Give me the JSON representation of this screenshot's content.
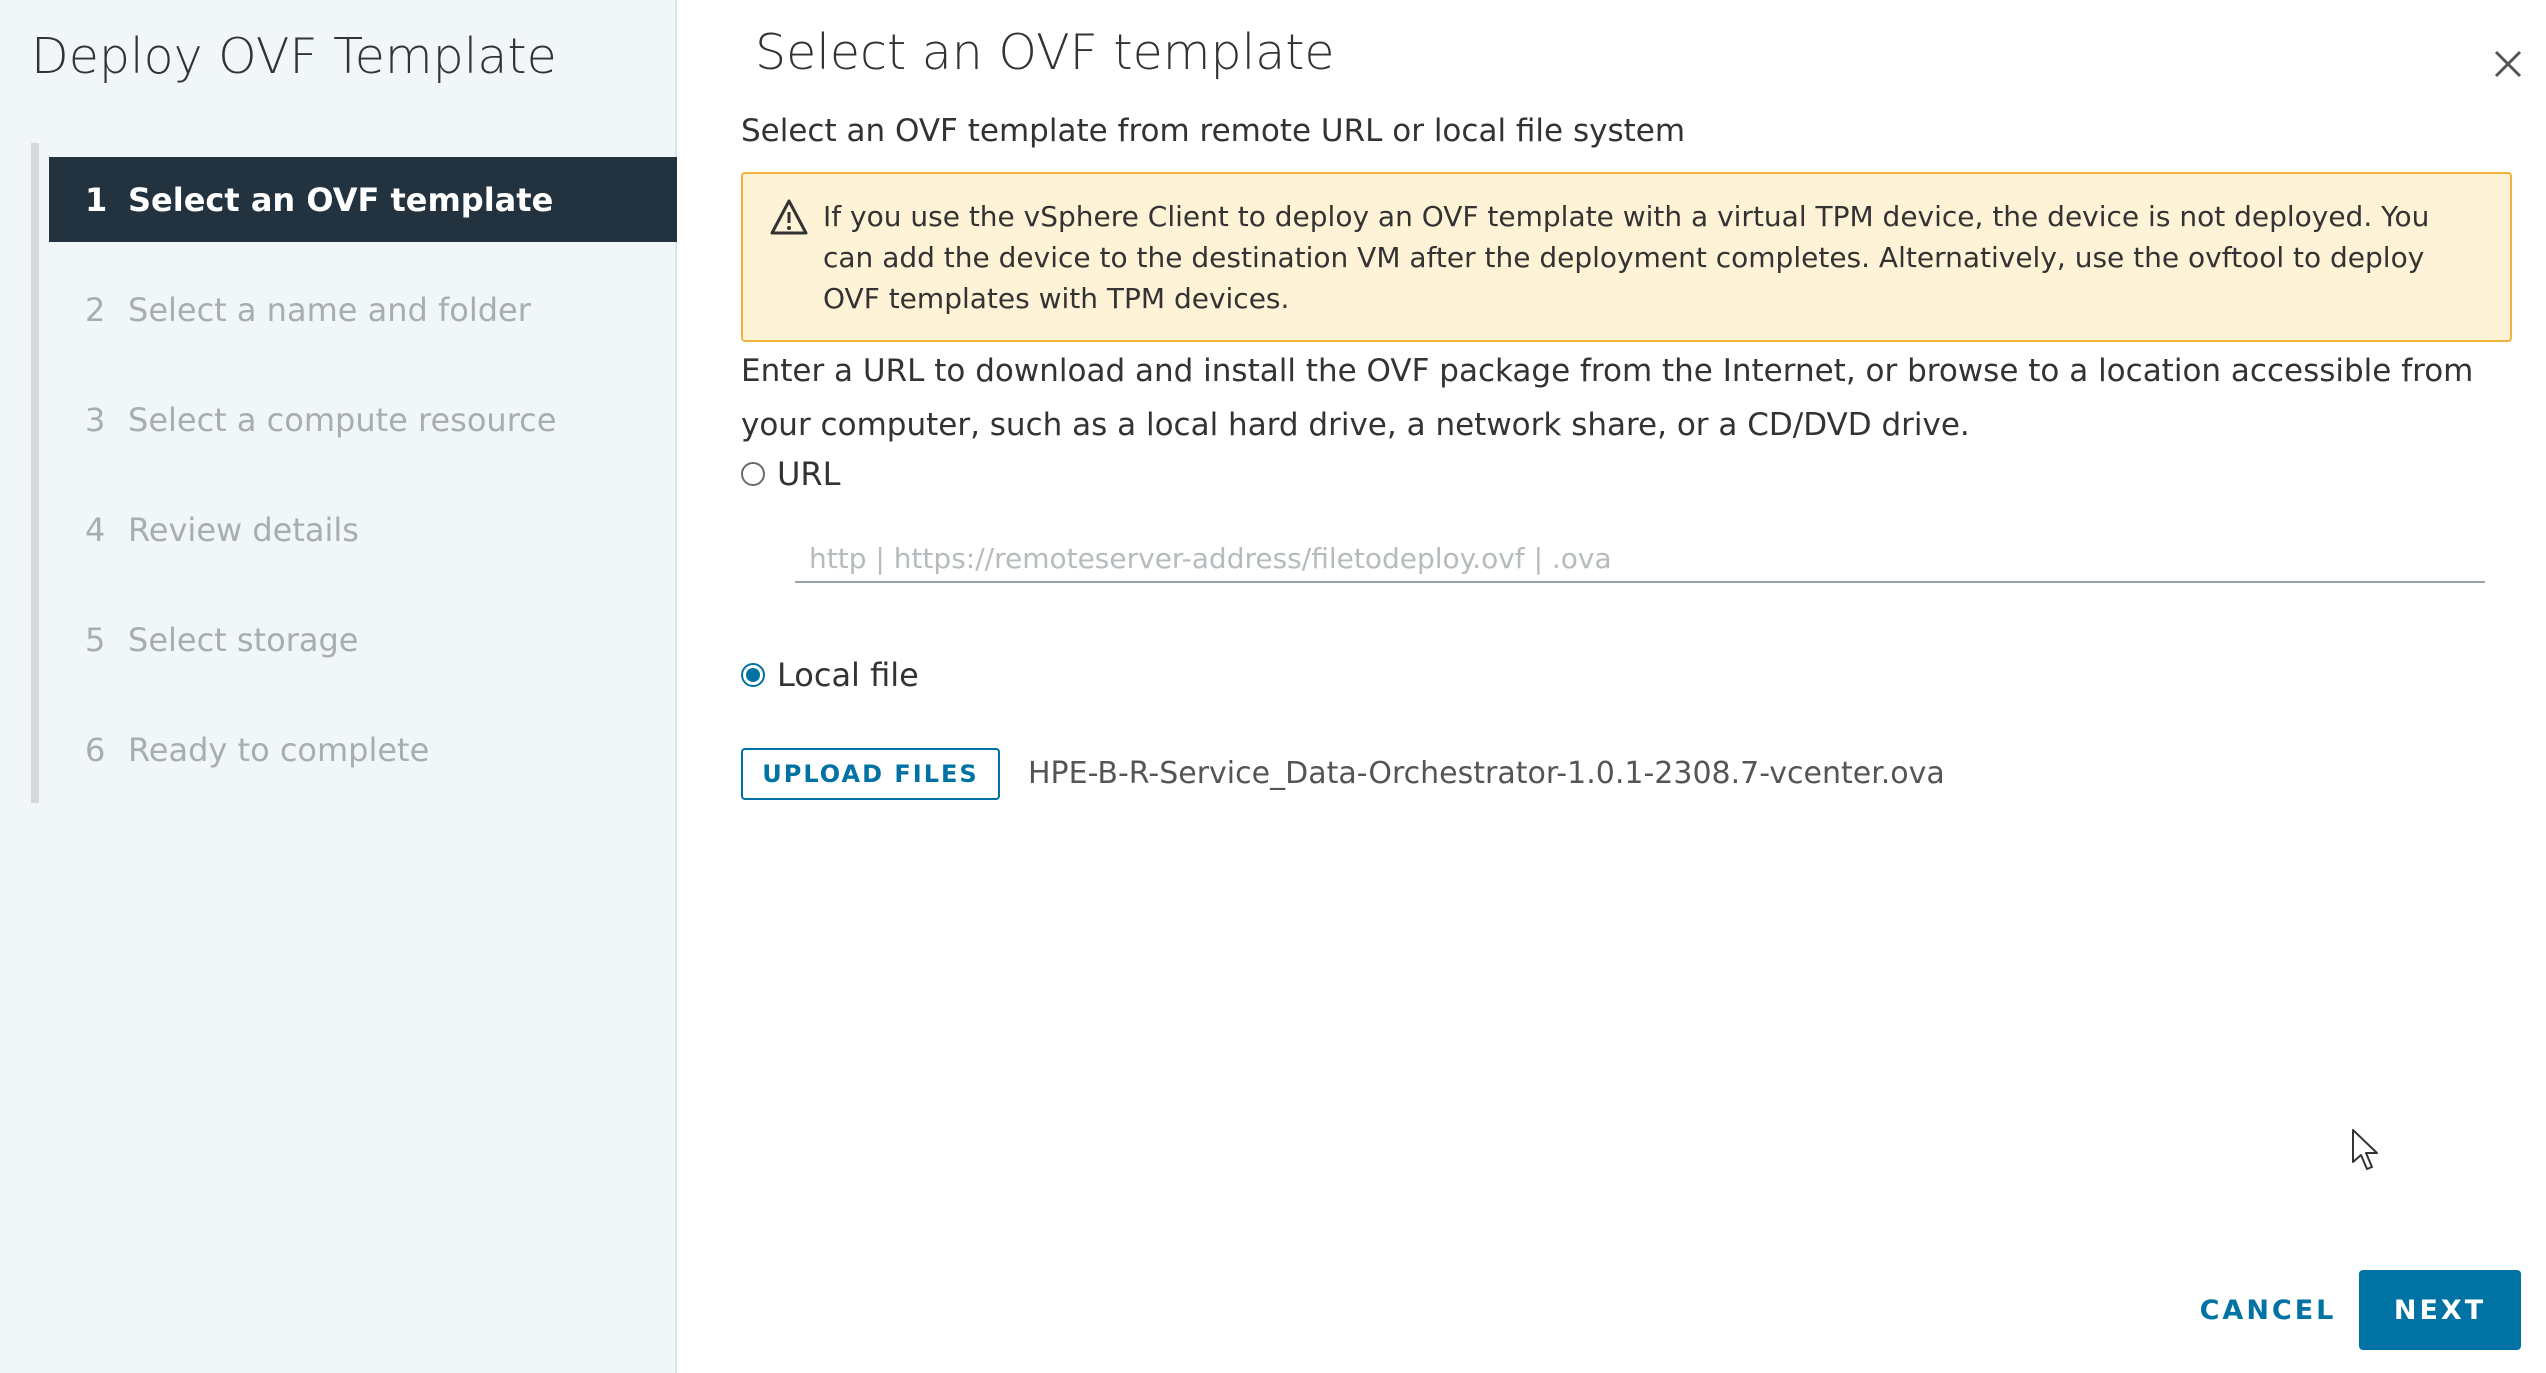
{
  "sidebar": {
    "title": "Deploy OVF Template",
    "steps": [
      {
        "num": "1",
        "label": "Select an OVF template"
      },
      {
        "num": "2",
        "label": "Select a name and folder"
      },
      {
        "num": "3",
        "label": "Select a compute resource"
      },
      {
        "num": "4",
        "label": "Review details"
      },
      {
        "num": "5",
        "label": "Select storage"
      },
      {
        "num": "6",
        "label": "Ready to complete"
      }
    ]
  },
  "main": {
    "title": "Select an OVF template",
    "subtitle": "Select an OVF template from remote URL or local file system",
    "alert": {
      "icon": "warning-triangle-icon",
      "text": "If you use the vSphere Client to deploy an OVF template with a virtual TPM device, the device is not deployed. You can add the device to the destination VM after the deployment completes. Alternatively, use the ovftool to deploy OVF templates with TPM devices."
    },
    "description": "Enter a URL to download and install the OVF package from the Internet, or browse to a location accessible from your computer, such as a local hard drive, a network share, or a CD/DVD drive.",
    "url_option": {
      "label": "URL",
      "selected": false,
      "value": "",
      "placeholder": "http | https://remoteserver-address/filetodeploy.ovf | .ova"
    },
    "local_option": {
      "label": "Local file",
      "selected": true
    },
    "upload_label": "UPLOAD FILES",
    "file_name": "HPE-B-R-Service_Data-Orchestrator-1.0.1-2308.7-vcenter.ova"
  },
  "footer": {
    "cancel_label": "CANCEL",
    "next_label": "NEXT"
  },
  "colors": {
    "accent": "#0072a3",
    "active_step_bg": "#22333f",
    "alert_bg": "#fef3d6",
    "alert_border": "#f2b33d"
  }
}
